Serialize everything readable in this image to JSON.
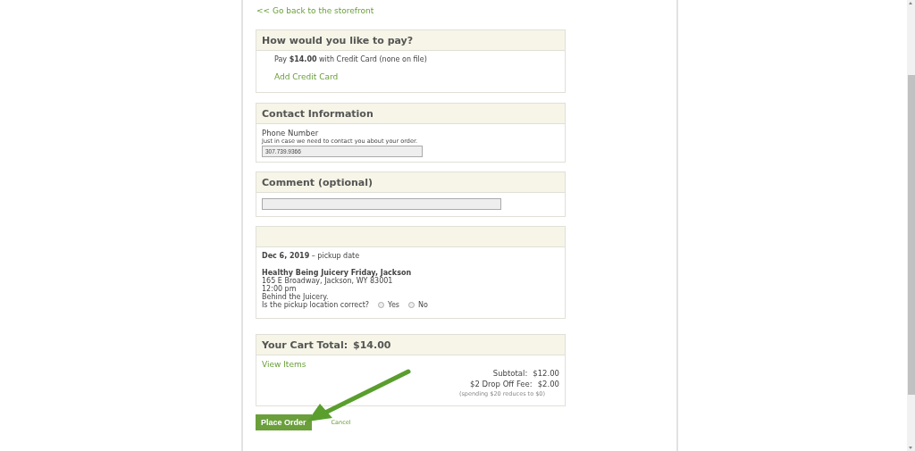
{
  "back_link": "<< Go back to the storefront",
  "payment": {
    "title": "How would you like to pay?",
    "text": "Pay **$14.00** with Credit Card (none on file)",
    "add_link": "Add Credit Card"
  },
  "contact": {
    "title": "Contact Information",
    "label": "Phone Number",
    "hint": "Just in case we need to contact you about your order.",
    "phone": "307.739.9366"
  },
  "comment": {
    "title": "Comment (optional)"
  },
  "pickup": {
    "date": "Dec 6, 2019",
    "date_note": "– pickup date",
    "location": "Healthy Being Juicery Friday, Jackson",
    "lines": [
      "165 E Broadway, Jackson, WY 83001",
      "12:00 pm",
      "Behind the Juicery."
    ],
    "question": "Is the pickup location correct?",
    "options": [
      {
        "label": "Yes",
        "selected": false
      },
      {
        "label": "No",
        "selected": false
      }
    ]
  },
  "cart": {
    "title": "Your Cart Total:",
    "total": "$14.00",
    "view_link": "View Items",
    "rows": [
      {
        "label": "Subtotal:",
        "value": "$12.00"
      },
      {
        "label": "$2 Drop Off Fee:",
        "value": "$2.00"
      }
    ],
    "note": "(spending $20 reduces to $0)"
  },
  "buttons": {
    "place": "Place Order",
    "cancel": "Cancel"
  }
}
